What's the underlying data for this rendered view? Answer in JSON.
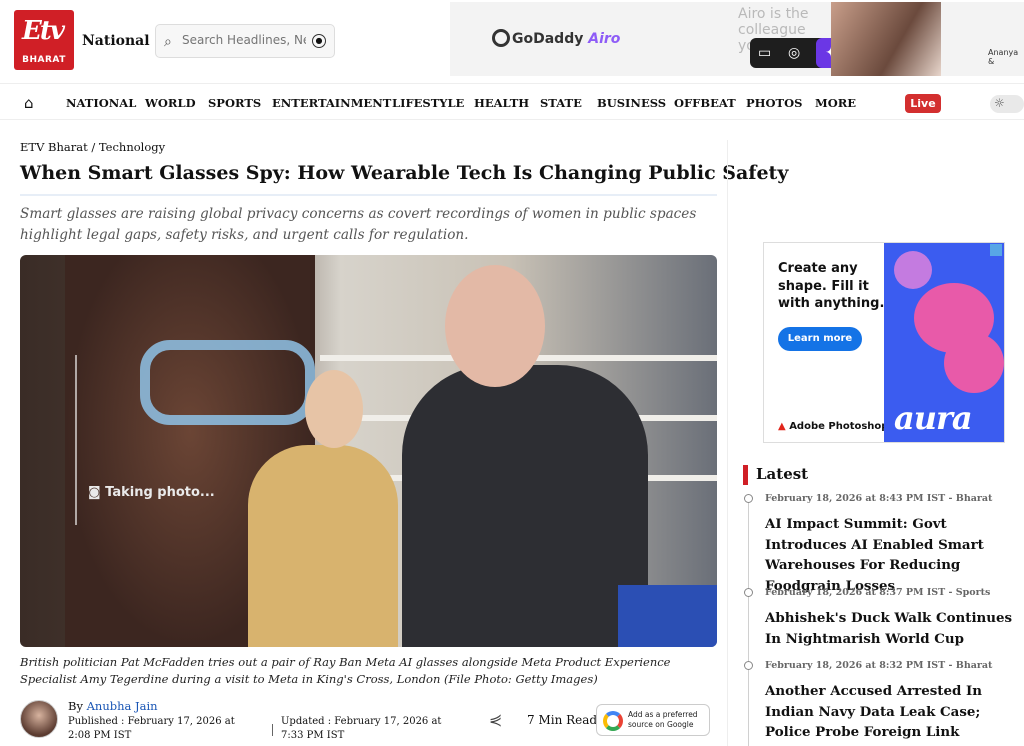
{
  "header": {
    "logo_text": "Etv",
    "logo_word": "BHARAT",
    "edition": "National",
    "search_placeholder": "Search Headlines, News..."
  },
  "top_ad": {
    "brand": "GoDaddy",
    "brand_suffix": "Airo",
    "copy": "Airo is the colleague you wanted.",
    "caption": "Ananya &"
  },
  "nav": {
    "items": [
      "NATIONAL",
      "WORLD",
      "SPORTS",
      "ENTERTAINMENT",
      "LIFESTYLE",
      "HEALTH",
      "STATE",
      "BUSINESS",
      "OFFBEAT",
      "PHOTOS",
      "MORE"
    ],
    "live": "Live"
  },
  "article": {
    "breadcrumb": "ETV Bharat / Technology",
    "headline": "When Smart Glasses Spy: How Wearable Tech Is Changing Public Safety",
    "summary": "Smart glasses are raising global privacy concerns as covert recordings of women in public spaces highlight legal gaps, safety risks, and urgent calls for regulation.",
    "image_overlay_text": "Taking photo...",
    "caption": "British politician Pat McFadden tries out a pair of Ray Ban Meta AI glasses alongside Meta Product Experience Specialist Amy Tegerdine during a visit to Meta in King's Cross, London (File Photo: Getty Images)",
    "by_label": "By",
    "author": "Anubha Jain",
    "published": "Published : February 17, 2026 at 2:08 PM IST",
    "updated": "Updated : February 17, 2026 at 7:33 PM IST",
    "read_time": "7 Min Read",
    "google_pref": "Add as a preferred source on Google"
  },
  "side_ad": {
    "copy": "Create any shape. Fill it with anything.",
    "button": "Learn more",
    "brand": "Adobe Photoshop",
    "art_word": "aura"
  },
  "latest": {
    "heading": "Latest",
    "items": [
      {
        "meta": "February 18, 2026 at 8:43 PM IST - Bharat",
        "title": "AI Impact Summit: Govt Introduces AI Enabled Smart Warehouses For Reducing Foodgrain Losses"
      },
      {
        "meta": "February 18, 2026 at 8:37 PM IST - Sports",
        "title": "Abhishek's Duck Walk Continues In Nightmarish World Cup"
      },
      {
        "meta": "February 18, 2026 at 8:32 PM IST - Bharat",
        "title": "Another Accused Arrested In Indian Navy Data Leak Case; Police Probe Foreign Link"
      }
    ]
  },
  "colors": {
    "brand_red": "#d01f26",
    "live_red": "#d32f2f",
    "link_blue": "#1a56b5"
  }
}
